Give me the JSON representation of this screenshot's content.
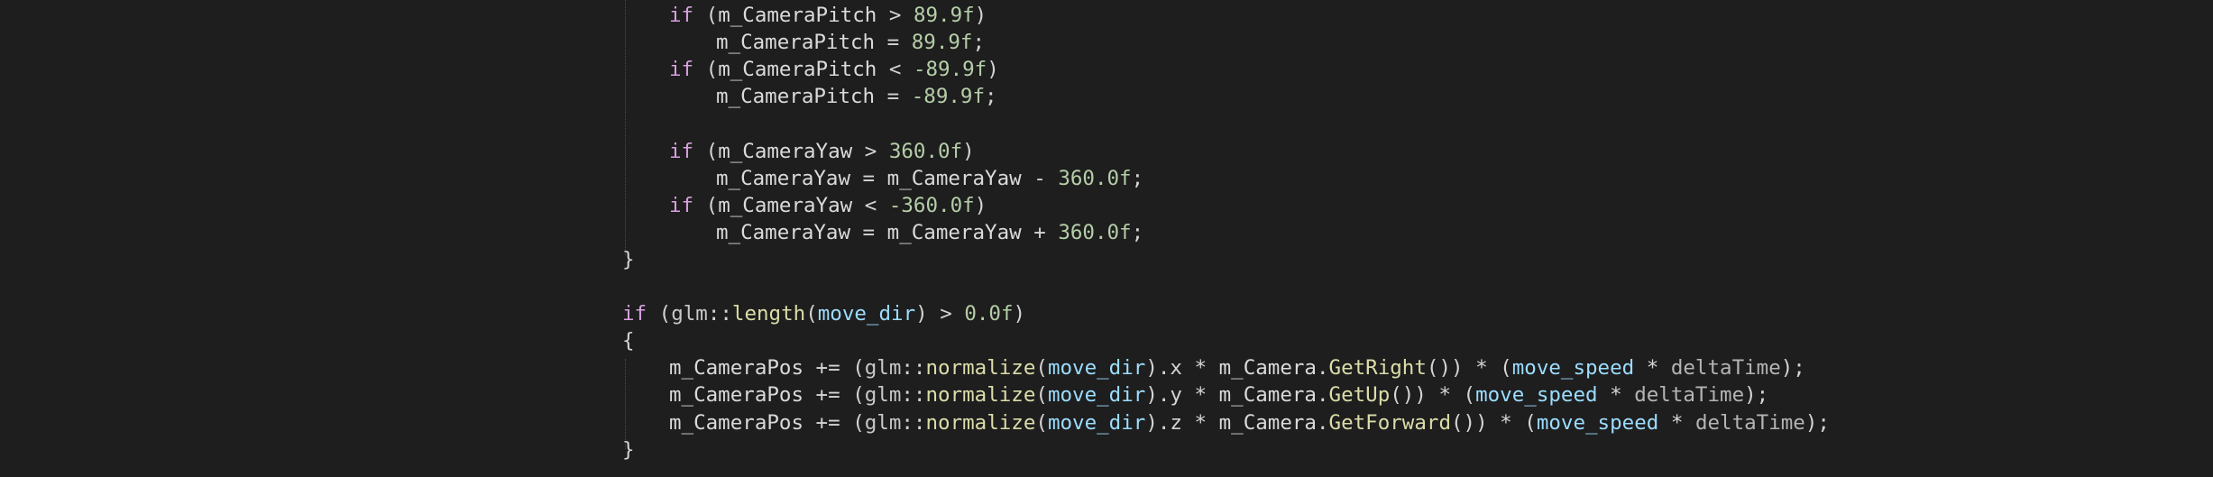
{
  "editor": {
    "theme_colors": {
      "background": "#1e1e1e",
      "default": "#d4d4d4",
      "keyword": "#d8a0df",
      "function": "#dcdcaa",
      "number": "#b5cea8",
      "parameter": "#9cdcfe",
      "variable": "#dadada",
      "namespace": "#c8c8c8",
      "member_field": "#dadada",
      "local": "#9cdcfe",
      "dim": "#b4b4b4"
    },
    "lines": [
      {
        "indent": 1,
        "tokens": [
          {
            "text": "if",
            "kind": "keyword"
          },
          {
            "text": " (",
            "kind": "default"
          },
          {
            "text": "m_CameraPitch",
            "kind": "member_field"
          },
          {
            "text": " > ",
            "kind": "default"
          },
          {
            "text": "89.9f",
            "kind": "number"
          },
          {
            "text": ")",
            "kind": "default"
          }
        ]
      },
      {
        "indent": 2,
        "tokens": [
          {
            "text": "m_CameraPitch",
            "kind": "member_field"
          },
          {
            "text": " = ",
            "kind": "default"
          },
          {
            "text": "89.9f",
            "kind": "number"
          },
          {
            "text": ";",
            "kind": "default"
          }
        ]
      },
      {
        "indent": 1,
        "tokens": [
          {
            "text": "if",
            "kind": "keyword"
          },
          {
            "text": " (",
            "kind": "default"
          },
          {
            "text": "m_CameraPitch",
            "kind": "member_field"
          },
          {
            "text": " < ",
            "kind": "default"
          },
          {
            "text": "-89.9f",
            "kind": "number"
          },
          {
            "text": ")",
            "kind": "default"
          }
        ]
      },
      {
        "indent": 2,
        "tokens": [
          {
            "text": "m_CameraPitch",
            "kind": "member_field"
          },
          {
            "text": " = ",
            "kind": "default"
          },
          {
            "text": "-89.9f",
            "kind": "number"
          },
          {
            "text": ";",
            "kind": "default"
          }
        ]
      },
      {
        "indent": 0,
        "tokens": []
      },
      {
        "indent": 1,
        "tokens": [
          {
            "text": "if",
            "kind": "keyword"
          },
          {
            "text": " (",
            "kind": "default"
          },
          {
            "text": "m_CameraYaw",
            "kind": "member_field"
          },
          {
            "text": " > ",
            "kind": "default"
          },
          {
            "text": "360.0f",
            "kind": "number"
          },
          {
            "text": ")",
            "kind": "default"
          }
        ]
      },
      {
        "indent": 2,
        "tokens": [
          {
            "text": "m_CameraYaw",
            "kind": "member_field"
          },
          {
            "text": " = ",
            "kind": "default"
          },
          {
            "text": "m_CameraYaw",
            "kind": "member_field"
          },
          {
            "text": " - ",
            "kind": "default"
          },
          {
            "text": "360.0f",
            "kind": "number"
          },
          {
            "text": ";",
            "kind": "default"
          }
        ]
      },
      {
        "indent": 1,
        "tokens": [
          {
            "text": "if",
            "kind": "keyword"
          },
          {
            "text": " (",
            "kind": "default"
          },
          {
            "text": "m_CameraYaw",
            "kind": "member_field"
          },
          {
            "text": " < ",
            "kind": "default"
          },
          {
            "text": "-360.0f",
            "kind": "number"
          },
          {
            "text": ")",
            "kind": "default"
          }
        ]
      },
      {
        "indent": 2,
        "tokens": [
          {
            "text": "m_CameraYaw",
            "kind": "member_field"
          },
          {
            "text": " = ",
            "kind": "default"
          },
          {
            "text": "m_CameraYaw",
            "kind": "member_field"
          },
          {
            "text": " + ",
            "kind": "default"
          },
          {
            "text": "360.0f",
            "kind": "number"
          },
          {
            "text": ";",
            "kind": "default"
          }
        ]
      },
      {
        "indent": 0,
        "tokens": [
          {
            "text": "}",
            "kind": "default"
          }
        ]
      },
      {
        "indent": 0,
        "tokens": []
      },
      {
        "indent": 0,
        "tokens": [
          {
            "text": "if",
            "kind": "keyword"
          },
          {
            "text": " (",
            "kind": "default"
          },
          {
            "text": "glm",
            "kind": "namespace"
          },
          {
            "text": "::",
            "kind": "default"
          },
          {
            "text": "length",
            "kind": "function"
          },
          {
            "text": "(",
            "kind": "default"
          },
          {
            "text": "move_dir",
            "kind": "local"
          },
          {
            "text": ") > ",
            "kind": "default"
          },
          {
            "text": "0.0f",
            "kind": "number"
          },
          {
            "text": ")",
            "kind": "default"
          }
        ]
      },
      {
        "indent": 0,
        "tokens": [
          {
            "text": "{",
            "kind": "default"
          }
        ]
      },
      {
        "indent": 1,
        "tokens": [
          {
            "text": "m_CameraPos",
            "kind": "member_field"
          },
          {
            "text": " += (",
            "kind": "default"
          },
          {
            "text": "glm",
            "kind": "namespace"
          },
          {
            "text": "::",
            "kind": "default"
          },
          {
            "text": "normalize",
            "kind": "function"
          },
          {
            "text": "(",
            "kind": "default"
          },
          {
            "text": "move_dir",
            "kind": "local"
          },
          {
            "text": ").x * ",
            "kind": "default"
          },
          {
            "text": "m_Camera",
            "kind": "member_field"
          },
          {
            "text": ".",
            "kind": "default"
          },
          {
            "text": "GetRight",
            "kind": "function"
          },
          {
            "text": "()) * (",
            "kind": "default"
          },
          {
            "text": "move_speed",
            "kind": "local"
          },
          {
            "text": " * ",
            "kind": "default"
          },
          {
            "text": "deltaTime",
            "kind": "dim"
          },
          {
            "text": ");",
            "kind": "default"
          }
        ]
      },
      {
        "indent": 1,
        "tokens": [
          {
            "text": "m_CameraPos",
            "kind": "member_field"
          },
          {
            "text": " += (",
            "kind": "default"
          },
          {
            "text": "glm",
            "kind": "namespace"
          },
          {
            "text": "::",
            "kind": "default"
          },
          {
            "text": "normalize",
            "kind": "function"
          },
          {
            "text": "(",
            "kind": "default"
          },
          {
            "text": "move_dir",
            "kind": "local"
          },
          {
            "text": ").y * ",
            "kind": "default"
          },
          {
            "text": "m_Camera",
            "kind": "member_field"
          },
          {
            "text": ".",
            "kind": "default"
          },
          {
            "text": "GetUp",
            "kind": "function"
          },
          {
            "text": "()) * (",
            "kind": "default"
          },
          {
            "text": "move_speed",
            "kind": "local"
          },
          {
            "text": " * ",
            "kind": "default"
          },
          {
            "text": "deltaTime",
            "kind": "dim"
          },
          {
            "text": ");",
            "kind": "default"
          }
        ]
      },
      {
        "indent": 1,
        "tokens": [
          {
            "text": "m_CameraPos",
            "kind": "member_field"
          },
          {
            "text": " += (",
            "kind": "default"
          },
          {
            "text": "glm",
            "kind": "namespace"
          },
          {
            "text": "::",
            "kind": "default"
          },
          {
            "text": "normalize",
            "kind": "function"
          },
          {
            "text": "(",
            "kind": "default"
          },
          {
            "text": "move_dir",
            "kind": "local"
          },
          {
            "text": ").z * ",
            "kind": "default"
          },
          {
            "text": "m_Camera",
            "kind": "member_field"
          },
          {
            "text": ".",
            "kind": "default"
          },
          {
            "text": "GetForward",
            "kind": "function"
          },
          {
            "text": "()) * (",
            "kind": "default"
          },
          {
            "text": "move_speed",
            "kind": "local"
          },
          {
            "text": " * ",
            "kind": "default"
          },
          {
            "text": "deltaTime",
            "kind": "dim"
          },
          {
            "text": ");",
            "kind": "default"
          }
        ]
      },
      {
        "indent": 0,
        "tokens": [
          {
            "text": "}",
            "kind": "default"
          }
        ]
      }
    ]
  }
}
